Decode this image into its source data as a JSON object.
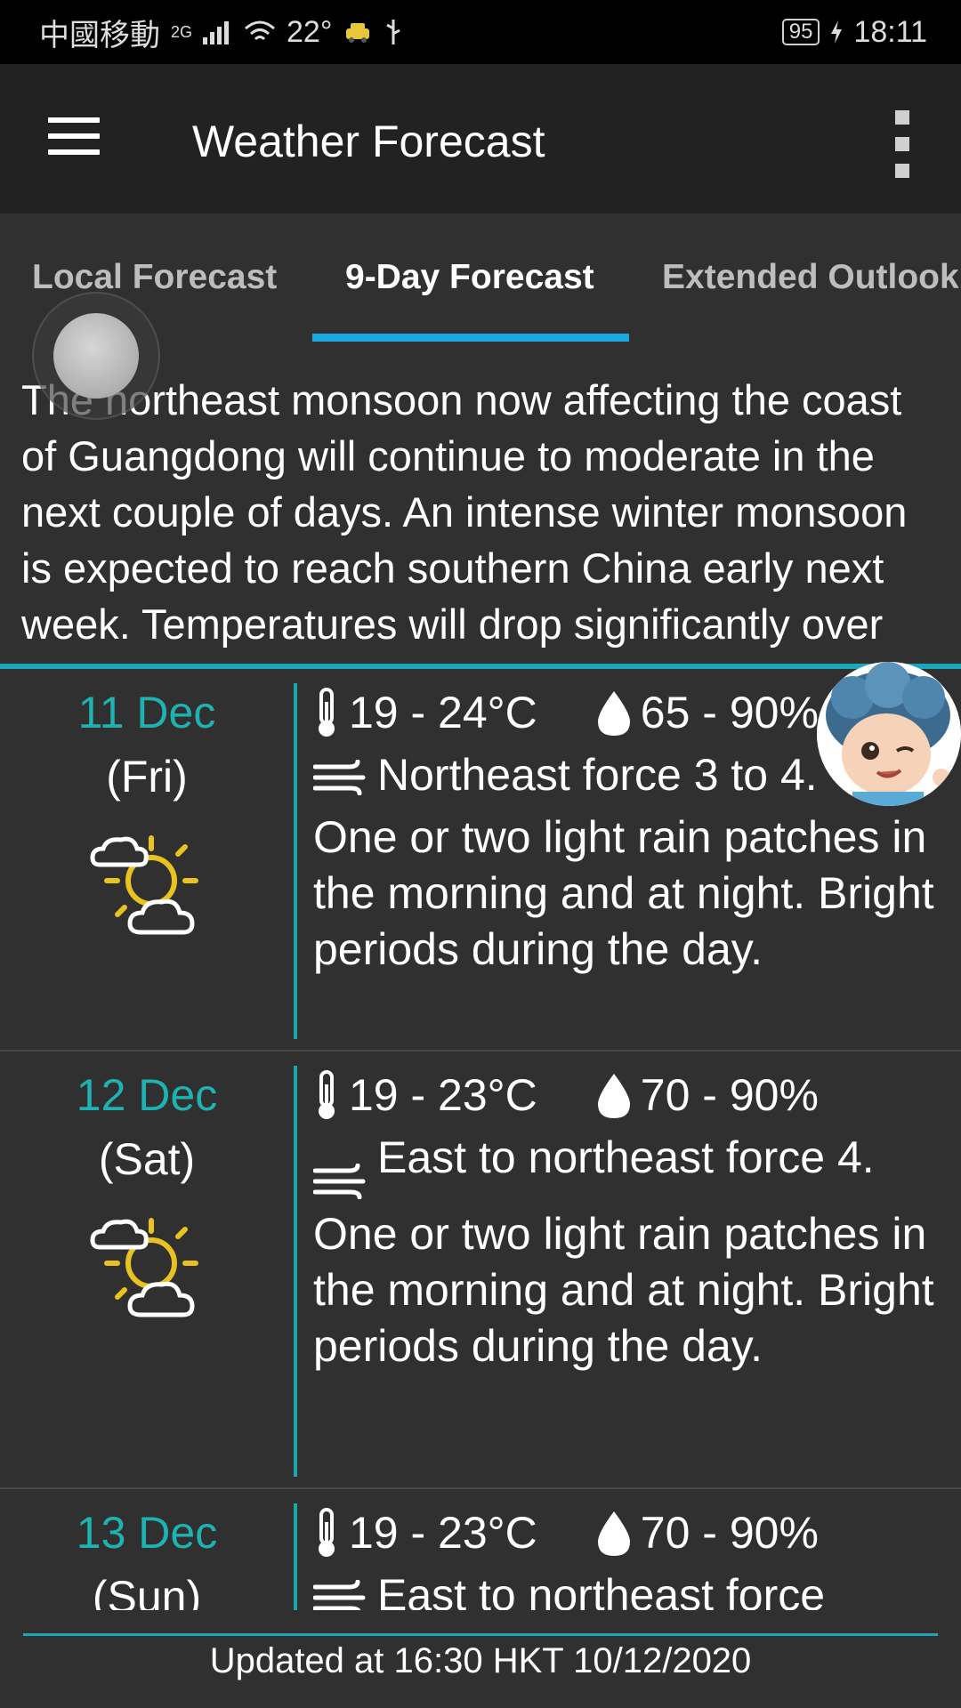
{
  "status_bar": {
    "carrier": "中國移動",
    "network": "2G",
    "temperature": "22°",
    "battery": "95",
    "time": "18:11",
    "icons": [
      "signal-icon",
      "wifi-icon",
      "car-icon",
      "usb-icon",
      "battery-icon",
      "charging-icon"
    ]
  },
  "appbar": {
    "title": "Weather Forecast",
    "menu_icon": "hamburger-menu-icon",
    "more_icon": "more-vert-icon"
  },
  "tabs": [
    {
      "label": "Local Forecast",
      "active": false
    },
    {
      "label": "9-Day Forecast",
      "active": true
    },
    {
      "label": "Extended Outlook",
      "active": false
    }
  ],
  "summary": "The northeast monsoon now affecting the coast of Guangdong will continue to moderate in the next couple of days. An intense winter monsoon is expected to reach southern China early next week. Temperatures will drop significantly over",
  "days": [
    {
      "date": "11 Dec",
      "weekday": "(Fri)",
      "icon": "sunny-periods-cloudy-icon",
      "temp": "19 - 24°C",
      "humidity": "65 - 90%",
      "wind": "Northeast force 3 to 4.",
      "desc": "One or two light rain patches in the morning and at night. Bright periods during the day."
    },
    {
      "date": "12 Dec",
      "weekday": "(Sat)",
      "icon": "sunny-periods-cloudy-icon",
      "temp": "19 - 23°C",
      "humidity": "70 - 90%",
      "wind": "East to northeast force 4.",
      "desc": "One or two light rain patches in the morning and at night. Bright periods during the day."
    },
    {
      "date": "13 Dec",
      "weekday": "(Sun)",
      "icon": "sunny-periods-cloudy-icon",
      "temp": "19 - 23°C",
      "humidity": "70 - 90%",
      "wind": "East to northeast force",
      "desc": ""
    }
  ],
  "footer": "Updated at 16:30 HKT 10/12/2020",
  "colors": {
    "accent_teal": "#1fb2b2",
    "tab_indicator": "#1aa8e0",
    "background": "#303030",
    "appbar": "#222222"
  }
}
